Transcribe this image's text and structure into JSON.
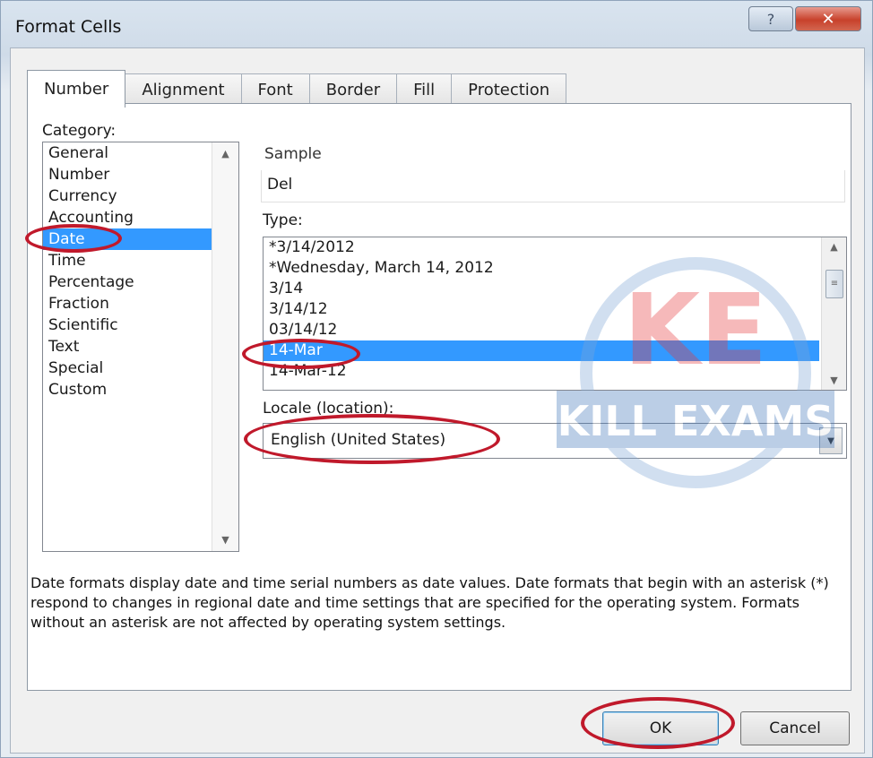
{
  "window": {
    "title": "Format Cells",
    "help_glyph": "?",
    "close_glyph": "✕"
  },
  "tabs": [
    {
      "label": "Number",
      "active": true
    },
    {
      "label": "Alignment",
      "active": false
    },
    {
      "label": "Font",
      "active": false
    },
    {
      "label": "Border",
      "active": false
    },
    {
      "label": "Fill",
      "active": false
    },
    {
      "label": "Protection",
      "active": false
    }
  ],
  "category": {
    "label": "Category:",
    "items": [
      "General",
      "Number",
      "Currency",
      "Accounting",
      "Date",
      "Time",
      "Percentage",
      "Fraction",
      "Scientific",
      "Text",
      "Special",
      "Custom"
    ],
    "selected": "Date"
  },
  "sample": {
    "label": "Sample",
    "value": "Del"
  },
  "type": {
    "label": "Type:",
    "items": [
      "*3/14/2012",
      "*Wednesday, March 14, 2012",
      "3/14",
      "3/14/12",
      "03/14/12",
      "14-Mar",
      "14-Mar-12"
    ],
    "selected": "14-Mar"
  },
  "locale": {
    "label": "Locale (location):",
    "value": "English (United States)"
  },
  "description": "Date formats display date and time serial numbers as date values.  Date formats that begin with an asterisk (*) respond to changes in regional date and time settings that are specified for the operating system. Formats without an asterisk are not affected by operating system settings.",
  "buttons": {
    "ok": "OK",
    "cancel": "Cancel"
  },
  "colors": {
    "selection": "#3399ff",
    "annotation_circle": "#c0192b"
  },
  "watermark": {
    "logo_text": "KE",
    "brand_text": "KILL EXAMS"
  }
}
